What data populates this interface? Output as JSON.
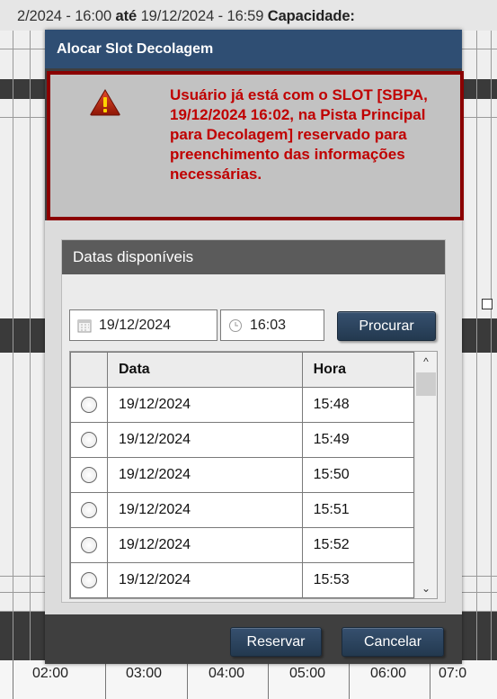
{
  "background": {
    "header_prefix": "2/2024 - 16:00",
    "header_ate": "até",
    "header_end": "19/12/2024 - 16:59",
    "header_capacity_label": "Capacidade:",
    "timeline_ticks": [
      "02:00",
      "03:00",
      "04:00",
      "05:00",
      "06:00",
      "07:0"
    ]
  },
  "dialog": {
    "title": "Alocar Slot Decolagem",
    "alert": {
      "icon": "warning-triangle-icon",
      "message": "Usuário já está com o SLOT [SBPA, 19/12/2024 16:02, na Pista Principal para Decolagem] reservado para preenchimento das informações necessárias."
    },
    "panel_title": "Datas disponíveis",
    "date_value": "19/12/2024",
    "time_value": "16:03",
    "search_label": "Procurar",
    "table": {
      "headers": [
        "",
        "Data",
        "Hora"
      ],
      "rows": [
        {
          "date": "19/12/2024",
          "time": "15:48"
        },
        {
          "date": "19/12/2024",
          "time": "15:49"
        },
        {
          "date": "19/12/2024",
          "time": "15:50"
        },
        {
          "date": "19/12/2024",
          "time": "15:51"
        },
        {
          "date": "19/12/2024",
          "time": "15:52"
        },
        {
          "date": "19/12/2024",
          "time": "15:53"
        }
      ]
    },
    "reserve_label": "Reservar",
    "cancel_label": "Cancelar"
  },
  "colors": {
    "title_bar": "#2f4e73",
    "alert_border": "#8b0000",
    "alert_text": "#c00000",
    "button": "#2b4360"
  }
}
